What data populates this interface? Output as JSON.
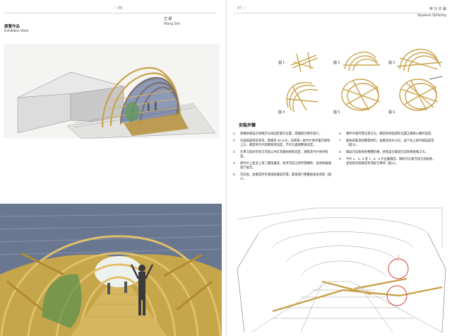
{
  "left_page": {
    "page_number": "86",
    "section_zh": "展覽作品",
    "section_en": "Exhibition Work",
    "author_zh": "王 紹",
    "author_en": "Wang Sho"
  },
  "right_page": {
    "page_number": "87",
    "tag_zh": "帝 分 亦 麗",
    "project_en": "Squeeze Sphering",
    "steps_title": "安裝步驟",
    "figures": [
      "圖 1",
      "圖 2",
      "圖 3",
      "圖 4",
      "圖 5",
      "圖 6"
    ],
    "steps": [
      {
        "n": "1.",
        "text": "建構依據設計規格於分段固定圖示位置，建議組合順序進行。"
      },
      {
        "n": "2.",
        "text": "先組裝圓環形骨架，間隔為 40 公分，再將第一組竹片依序置於鋼架上方，確認各竹片間間距與弧度，不均匀處調整後固定。"
      },
      {
        "n": "3.",
        "text": "在單元弧形桁架交叉點以木釘及鐵絲綁紮固定，鋼筋及竹片依序裝設。"
      },
      {
        "n": "4.",
        "text": "將竹片上面塗上第二層保護漆，依序完成全部所需構件，並依照編號進行組合。"
      },
      {
        "n": "5.",
        "text": "完成後，並確認所有連接點穩固可靠，最後進行整體檢查與清潔（圖 4）。"
      },
      {
        "n": "6.",
        "text": "構件吊裝時需注意方向，確認與地面連結位置正確後以螺栓固定。"
      },
      {
        "n": "7.",
        "text": "最後安裝頂部覆蓋材料，並確認排水方向，由下往上依序鋪設固定（圖 5）。"
      },
      {
        "n": "8.",
        "text": "鋪設完成後檢查整體結構，依照設計圖說完成現場收尾工作。"
      },
      {
        "n": "9.",
        "text": "竹片 1、3、5 及 7、8、9 片位置確認，間距均匀後完成全部組裝，並依照流程確認各項安全事項（圖 6）。"
      }
    ]
  }
}
